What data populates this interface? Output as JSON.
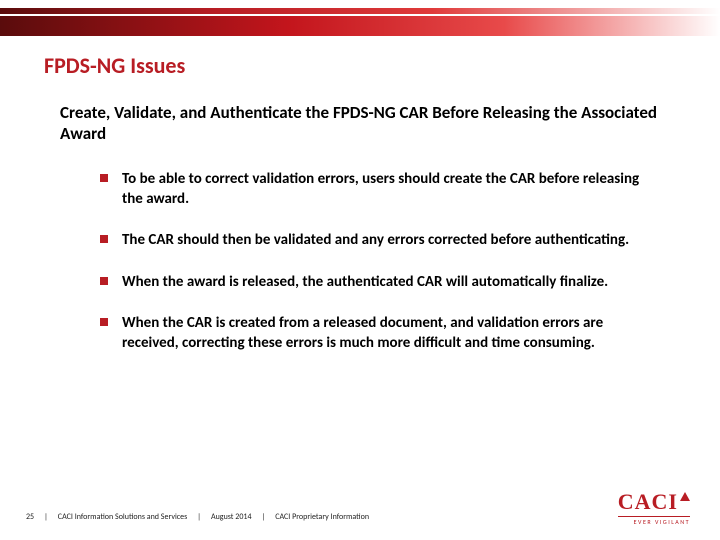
{
  "title": "FPDS-NG Issues",
  "subtitle": "Create, Validate, and Authenticate the FPDS-NG CAR Before Releasing the Associated Award",
  "bullets": [
    "To be able to correct validation errors, users should create the CAR before releasing the award.",
    "The CAR should then be validated and any errors corrected before authenticating.",
    "When the award is released, the authenticated CAR will automatically finalize.",
    "When the CAR is created from a released document, and validation errors are received, correcting these errors is much more difficult and time consuming."
  ],
  "footer": {
    "page": "25",
    "org": "CACI Information Solutions and Services",
    "date": "August 2014",
    "rights": "CACI Proprietary Information"
  },
  "logo": {
    "name": "CACI",
    "tagline": "EVER VIGILANT"
  }
}
